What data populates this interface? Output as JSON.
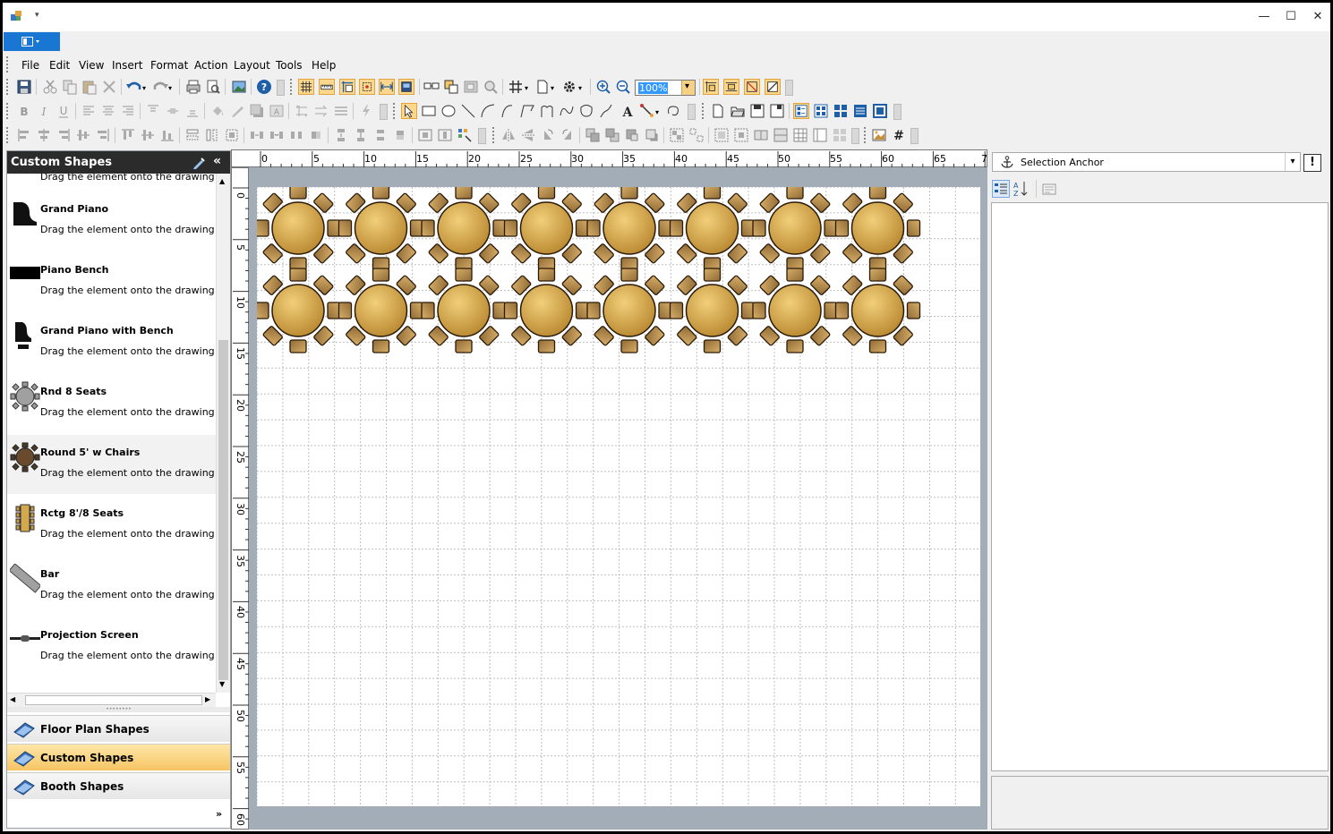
{
  "menu": {
    "items": [
      "File",
      "Edit",
      "View",
      "Insert",
      "Format",
      "Action",
      "Layout",
      "Tools",
      "Help"
    ]
  },
  "toolbar": {
    "zoom_value": "100%"
  },
  "left_panel": {
    "title": "Custom Shapes",
    "partial_desc": "Drag the element onto the drawing",
    "items": [
      {
        "name": "Grand Piano",
        "desc": "Drag the element onto the drawing",
        "icon": "grand-piano-icon"
      },
      {
        "name": "Piano Bench",
        "desc": "Drag the element onto the drawing",
        "icon": "piano-bench-icon"
      },
      {
        "name": "Grand Piano with Bench",
        "desc": "Drag the element onto the drawing",
        "icon": "grand-piano-bench-icon"
      },
      {
        "name": "Rnd 8 Seats",
        "desc": "Drag the element onto the drawing",
        "icon": "round-table-icon"
      },
      {
        "name": "Round 5' w Chairs",
        "desc": "Drag the element onto the drawing",
        "icon": "round-table-chairs-icon"
      },
      {
        "name": "Rctg 8'/8 Seats",
        "desc": "Drag the element onto the drawing",
        "icon": "rect-table-icon"
      },
      {
        "name": "Bar",
        "desc": "Drag the element onto the drawing",
        "icon": "bar-icon"
      },
      {
        "name": "Projection Screen",
        "desc": "Drag the element onto the drawing",
        "icon": "projection-screen-icon"
      }
    ],
    "tabs": [
      {
        "label": "Floor Plan Shapes",
        "selected": false
      },
      {
        "label": "Custom Shapes",
        "selected": true
      },
      {
        "label": "Booth Shapes",
        "selected": false
      }
    ]
  },
  "ruler": {
    "h_labels": [
      "0",
      "5",
      "10",
      "15",
      "20",
      "25",
      "30",
      "35",
      "40",
      "45",
      "50",
      "55",
      "60",
      "65",
      "7"
    ],
    "v_labels": [
      "0",
      "5",
      "10",
      "15",
      "20",
      "25",
      "30",
      "35",
      "40",
      "45",
      "50",
      "55",
      "60"
    ]
  },
  "drawing": {
    "rows": 2,
    "columns": 8,
    "table_color": "#d4a94e"
  },
  "right_panel": {
    "selection_label": "Selection Anchor"
  },
  "colors": {
    "accent": "#1976d2",
    "selected_tab": "#f7c463"
  }
}
